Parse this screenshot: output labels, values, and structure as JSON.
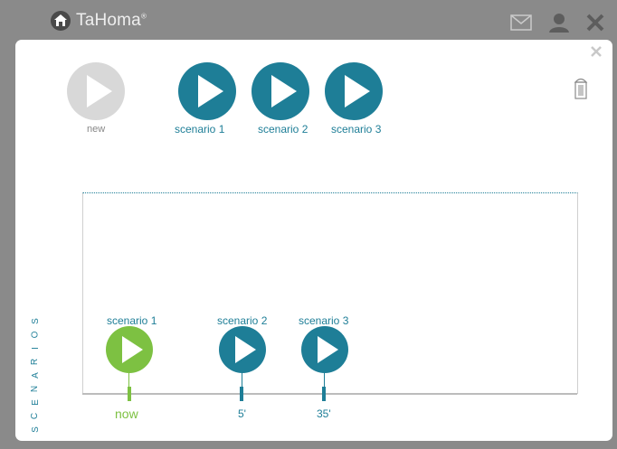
{
  "header": {
    "logo_text": "TaHoma",
    "logo_mark": "®",
    "icons": [
      "mail-icon",
      "user-icon",
      "close-icon"
    ]
  },
  "top_scenarios": [
    {
      "label": "new",
      "state": "disabled",
      "color": "#d8d8d8"
    },
    {
      "label": "scenario 1",
      "state": "active",
      "color": "#1e7e97"
    },
    {
      "label": "scenario 2",
      "state": "active",
      "color": "#1e7e97"
    },
    {
      "label": "scenario 3",
      "state": "active",
      "color": "#1e7e97"
    }
  ],
  "timeline": {
    "items": [
      {
        "label": "scenario 1",
        "time": "now",
        "color": "#7dc142"
      },
      {
        "label": "scenario 2",
        "time": "5'",
        "color": "#1e7e97"
      },
      {
        "label": "scenario 3",
        "time": "35'",
        "color": "#1e7e97"
      }
    ]
  },
  "side_label": "SCENARIOS",
  "colors": {
    "accent": "#1e7e97",
    "now": "#7dc142",
    "disabled": "#d8d8d8"
  }
}
